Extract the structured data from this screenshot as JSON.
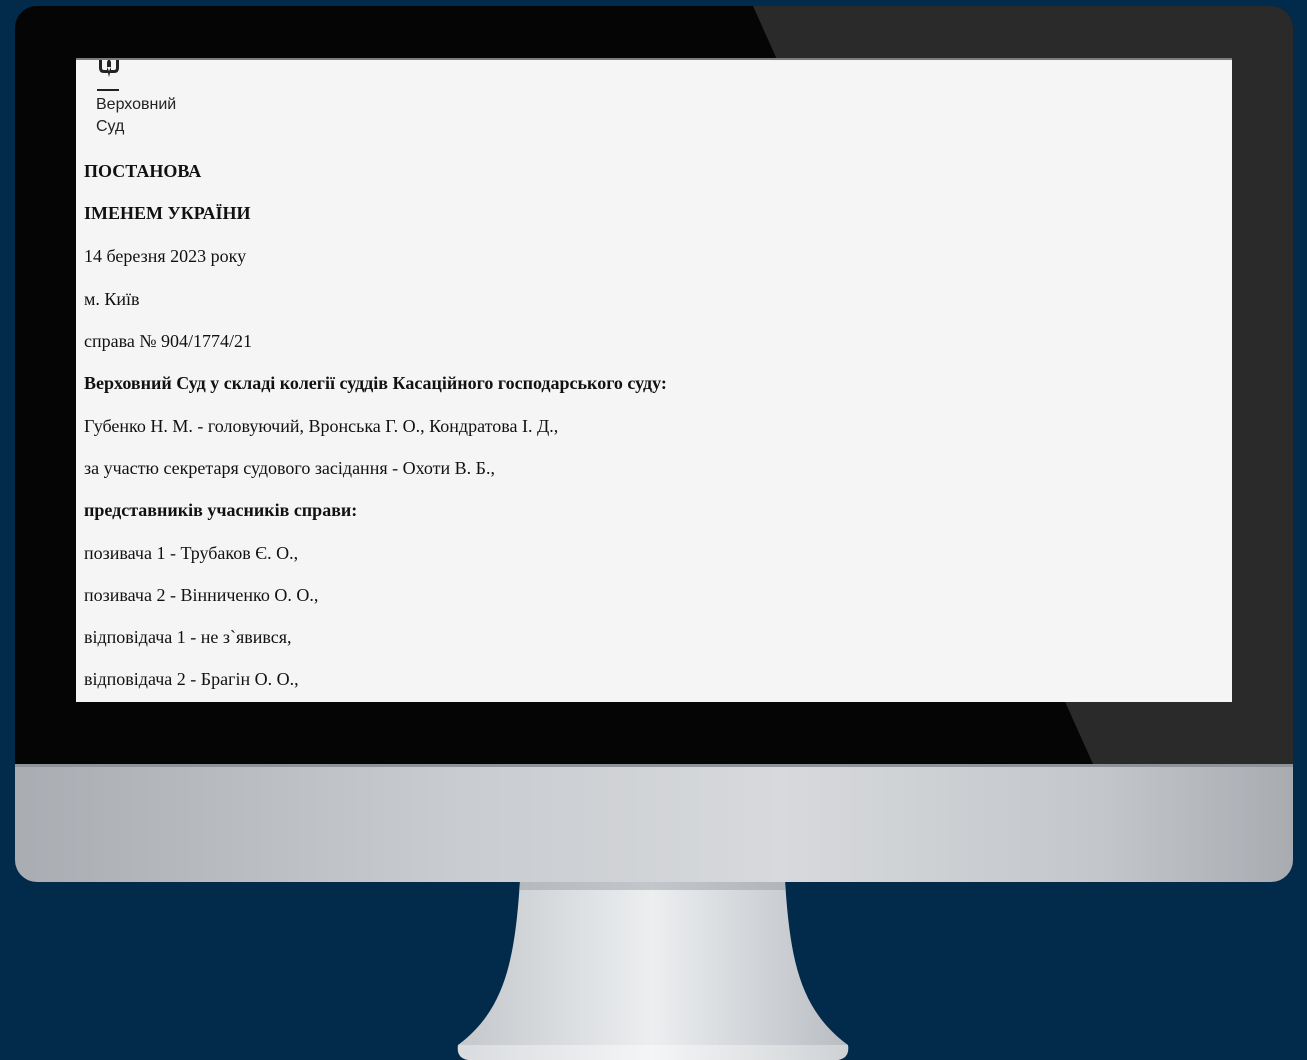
{
  "logo": {
    "emblem_icon": "trident-icon",
    "line1": "Верховний",
    "line2": "Суд"
  },
  "document": {
    "heading1": "ПОСТАНОВА",
    "heading2": "ІМЕНЕМ УКРАЇНИ",
    "date": "14 березня 2023 року",
    "city": "м. Київ",
    "case": "справа №  904/1774/21",
    "court_composition": "Верховний Суд у складі колегії суддів Касаційного господарського суду:",
    "judges": "Губенко Н. М. - головуючий, Вронська Г. О., Кондратова І. Д.,",
    "secretary": "за участю секретаря судового засідання - Охоти В. Б.,",
    "representatives_heading": "представників учасників справи:",
    "plaintiff1": "позивача 1 - Трубаков Є. О.,",
    "plaintiff2": "позивача 2 - Вінниченко О. О.,",
    "defendant1": "відповідача 1 - не з`явився,",
    "defendant2": "відповідача 2 - Брагін О. О.,"
  },
  "colors": {
    "background": "#022a4b",
    "bezel": "#050505",
    "screen": "#f5f5f5"
  }
}
